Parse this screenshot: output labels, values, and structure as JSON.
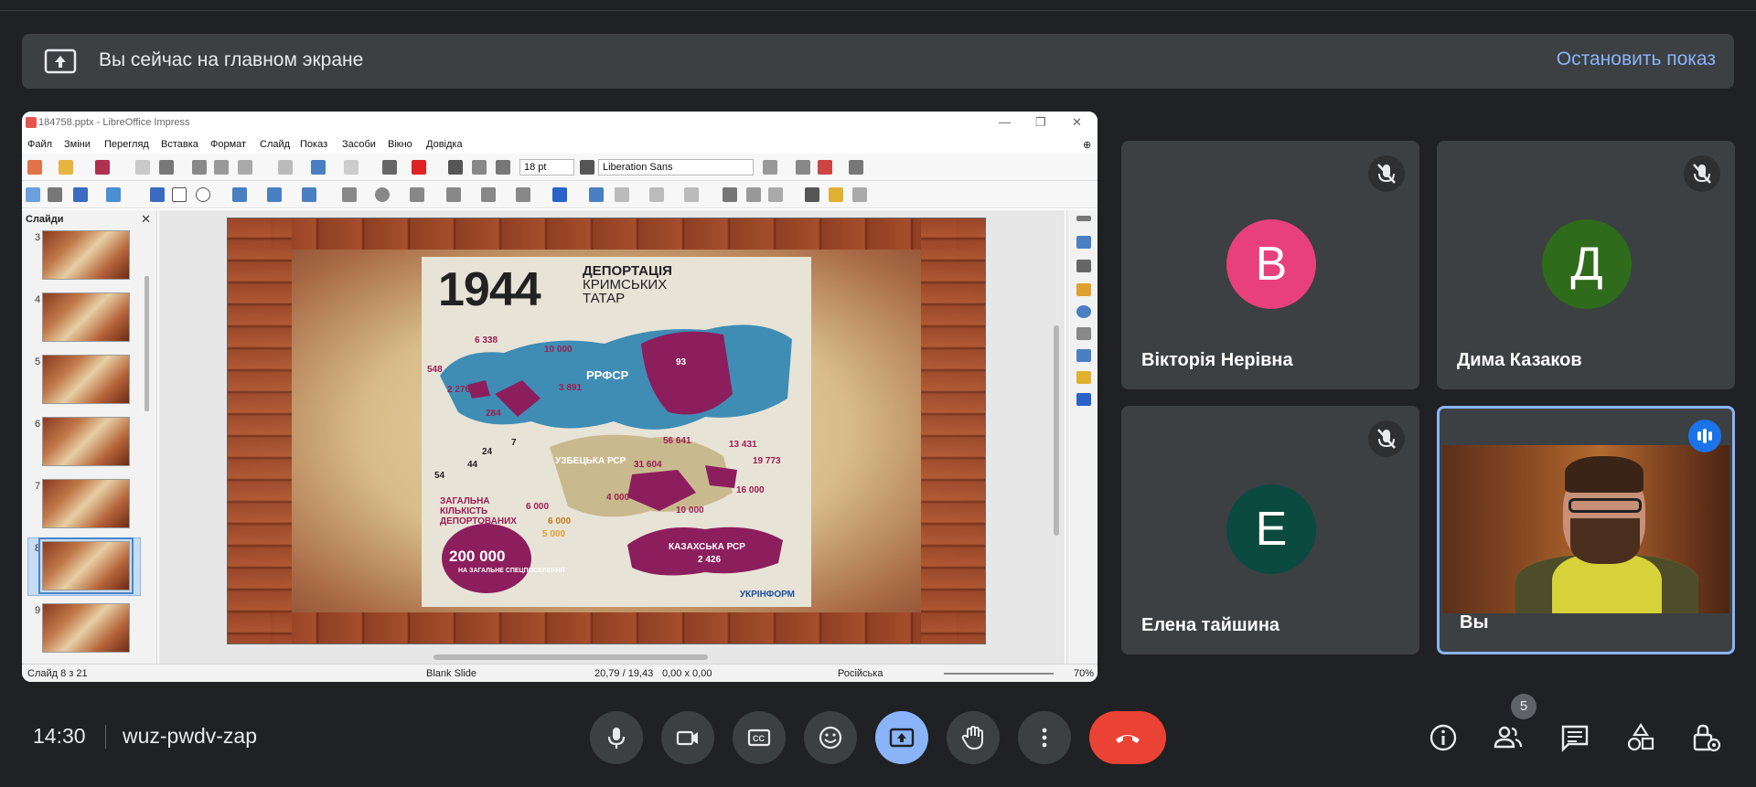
{
  "banner": {
    "text": "Вы сейчас на главном экране",
    "stop_label": "Остановить показ"
  },
  "impress": {
    "window_title": "184758.pptx - LibreOffice Impress",
    "menu": [
      "Файл",
      "Зміни",
      "Перегляд",
      "Вставка",
      "Формат",
      "Слайд",
      "Показ",
      "Засоби",
      "Вікно",
      "Довідка"
    ],
    "font_size": "18 pt",
    "font_name": "Liberation Sans",
    "slides_panel_title": "Слайди",
    "slide_numbers": [
      "3",
      "4",
      "5",
      "6",
      "7",
      "8",
      "9"
    ],
    "selected_slide": "8",
    "slide": {
      "year": "1944",
      "title_line1": "ДЕПОРТАЦІЯ",
      "title_line2": "КРИМСЬКИХ",
      "title_line3": "ТАТАР",
      "rfsr": "РРФСР",
      "uzbek": "УЗБЕЦЬКА РСР",
      "kazakh": "КАЗАХСЬКА РСР",
      "kazakh_num": "2 426",
      "total_label": "ЗАГАЛЬНА КІЛЬКІСТЬ ДЕПОРТОВАНИХ",
      "total_num": "200 000",
      "total_sub": "НА ЗАГАЛЬНЕ СПЕЦПОСЕЛЕННЯ",
      "n_6000a": "6 000",
      "n_6000b": "6 000",
      "n_5000": "5 000",
      "n_93": "93",
      "n_10000a": "10 000",
      "n_6338": "6 338",
      "n_548": "548",
      "n_3891": "3 891",
      "n_2276": "2 276",
      "n_284": "284",
      "n_56641": "56 641",
      "n_13431": "13 431",
      "n_31604": "31 604",
      "n_19773": "19 773",
      "n_4000": "4 000",
      "n_10000b": "10 000",
      "n_16000": "16 000",
      "n_7": "7",
      "n_24": "24",
      "n_44": "44",
      "n_54": "54",
      "brand": "УКРІНФОРМ"
    },
    "status": {
      "slide_of": "Слайд 8 з 21",
      "layout": "Blank Slide",
      "position": "20,79 / 19,43",
      "size": "0,00 x 0,00",
      "language": "Російська",
      "zoom": "70%"
    }
  },
  "participants": [
    {
      "initial": "В",
      "name": "Вікторія Нерівна",
      "color": "#e8407a",
      "muted": true
    },
    {
      "initial": "Д",
      "name": "Дима Казаков",
      "color": "#2e6b1a",
      "muted": true
    },
    {
      "initial": "Е",
      "name": "Елена тайшина",
      "color": "#0b4a3f",
      "muted": true
    },
    {
      "name": "Вы",
      "speaking": true
    }
  ],
  "footer": {
    "time": "14:30",
    "meeting_code": "wuz-pwdv-zap",
    "people_count": "5"
  },
  "colors": {
    "background": "#202124",
    "tile": "#3c4043",
    "accent_blue": "#8ab4f8",
    "end_call": "#ea4335"
  }
}
